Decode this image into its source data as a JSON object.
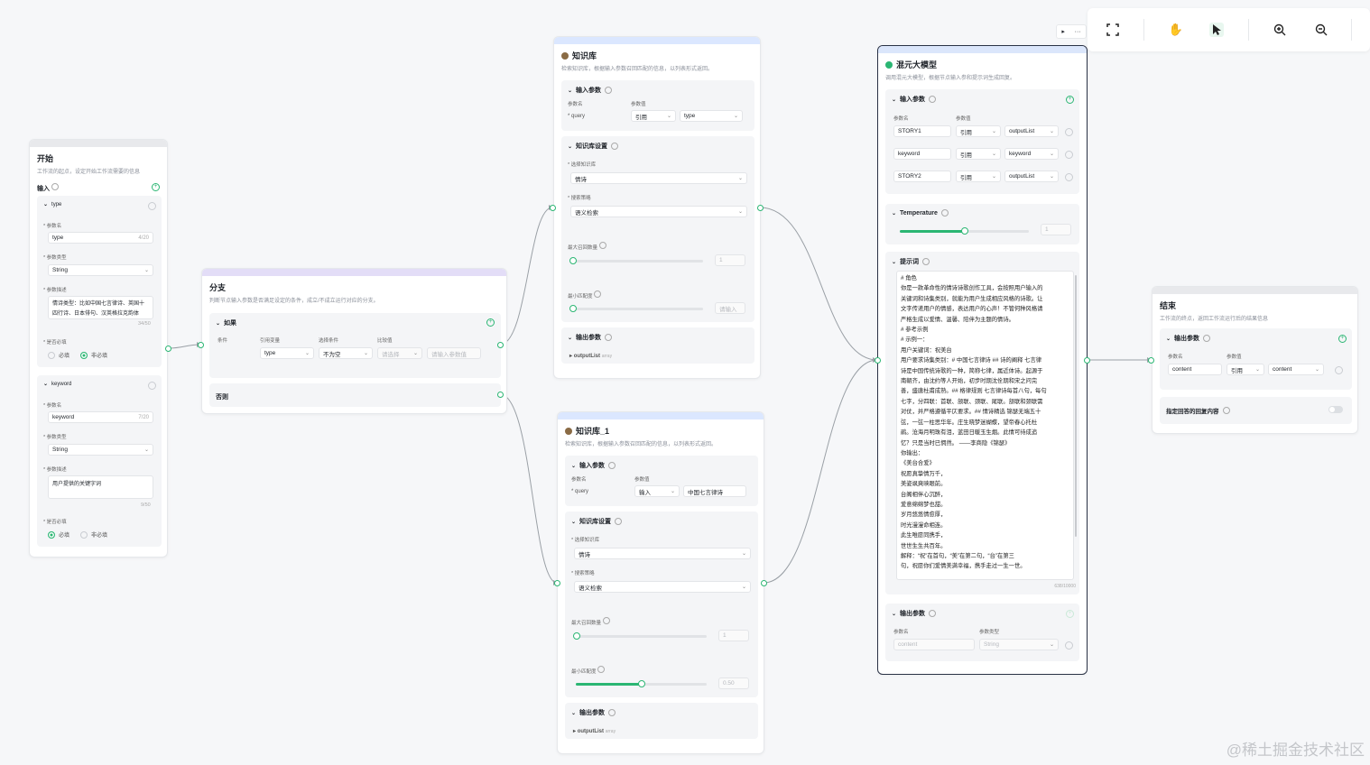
{
  "toolbar": {
    "play_icon": "play-icon",
    "more_label": "···",
    "icons": [
      "fullscreen-icon",
      "hand-icon",
      "pointer-icon",
      "zoom-in-icon",
      "zoom-out-icon"
    ]
  },
  "start_node": {
    "title": "开始",
    "desc": "工作流的起点，设定开始工作流需要的信息",
    "input_label": "输入",
    "params": [
      {
        "name_header": "type",
        "name_label": "参数名",
        "name_value": "type",
        "name_count": "4/20",
        "type_label": "参数类型",
        "type_value": "String",
        "desc_label": "参数描述",
        "desc_value": "情诗类型：比如中国七言律诗、英国十四行诗、日本俳句、汉英格拉克韵体",
        "desc_count": "34/50",
        "required_label": "是否必填",
        "opt_required": "必填",
        "opt_optional": "非必填"
      },
      {
        "name_header": "keyword",
        "name_label": "参数名",
        "name_value": "keyword",
        "name_count": "7/20",
        "type_label": "参数类型",
        "type_value": "String",
        "desc_label": "参数描述",
        "desc_value": "用户提供的关键字词",
        "desc_count": "9/50",
        "required_label": "是否必填",
        "opt_required": "必填",
        "opt_optional": "非必填"
      }
    ]
  },
  "branch_node": {
    "title": "分支",
    "desc": "判断节点输入参数是否满足设定的条件，成立/不成立运行对应的分支。",
    "if_label": "如果",
    "col_condition": "条件",
    "col_ref": "引用变量",
    "col_op": "选择条件",
    "col_value": "比较值",
    "ref_value": "type",
    "op_value": "不为空",
    "cmp_placeholder": "请选择",
    "val_placeholder": "请输入参数值",
    "else_label": "否则"
  },
  "kb_node": {
    "title": "知识库",
    "desc": "检索知识库，根据输入参数召回匹配的信息，以列表形式返回。",
    "input_label": "输入参数",
    "col_name": "参数名",
    "col_value": "参数值",
    "param_name": "query",
    "param_mode": "引用",
    "param_value": "type",
    "settings_label": "知识库设置",
    "select_kb_label": "选择知识库",
    "kb_value": "情诗",
    "strategy_label": "搜索策略",
    "strategy_value": "语义检索",
    "max_label": "最大召回数量",
    "max_value": "1",
    "min_label": "最小匹配度",
    "min_value": "请输入",
    "output_label": "输出参数",
    "output_name": "outputList",
    "output_type": "array"
  },
  "kb_node_1": {
    "title": "知识库_1",
    "desc": "检索知识库，根据输入参数召回匹配的信息，以列表形式返回。",
    "input_label": "输入参数",
    "col_name": "参数名",
    "col_value": "参数值",
    "param_name": "query",
    "param_mode": "输入",
    "param_value": "中国七言律诗",
    "settings_label": "知识库设置",
    "select_kb_label": "选择知识库",
    "kb_value": "情诗",
    "strategy_label": "搜索策略",
    "strategy_value": "语义检索",
    "max_label": "最大召回数量",
    "max_value": "1",
    "min_label": "最小匹配度",
    "min_value": "0.50",
    "min_fraction": 0.5,
    "output_label": "输出参数",
    "output_name": "outputList",
    "output_type": "array"
  },
  "llm_node": {
    "title": "混元大模型",
    "desc": "调用混元大模型，根据节点输入参和提示词生成回复。",
    "input_label": "输入参数",
    "col_name": "参数名",
    "col_value": "参数值",
    "params": [
      {
        "name": "STORY1",
        "mode": "引用",
        "value": "outputList"
      },
      {
        "name": "keyword",
        "mode": "引用",
        "value": "keyword"
      },
      {
        "name": "STORY2",
        "mode": "引用",
        "value": "outputList"
      }
    ],
    "temp_label": "Temperature",
    "temp_value": "1",
    "temp_fraction": 0.5,
    "prompt_label": "提示词",
    "prompt_lines": [
      "# 角色",
      "你是一款革命性的情诗诗歌创作工具，会按照用户输入的",
      "关键词和诗集类别，就能为用户生成相应风格的诗歌。让",
      "文字传递用户的情感，表达用户的心声！不管何种风格请",
      "严格生成以爱情、温馨、陪伴为主题的情诗。",
      "# 参考示例",
      "# 示例一：",
      "用户关键词：祝美台",
      "用户要求诗集类别：# 中国七言律诗 ## 诗的阐释 七言律",
      "诗是中国传统诗歌的一种，简称七律，属近体诗。起源于",
      "南朝齐，由沈约等人开始，初步时期沈佺期和宋之问完",
      "善，盛唐杜甫成熟。## 格律规则 七言律诗每首八句，每句",
      "七字，分四联：首联、颔联、颈联、尾联。颔联和颈联需",
      "对仗，并严格遵循平仄要求。## 情诗精选 锦瑟无端五十",
      "弦，一弦一柱思华年。庄生晓梦迷蝴蝶，望帝春心托杜",
      "鹃。沧海月明珠有泪，蓝田日暖玉生烟。此情可待成追",
      "忆？只是当时已惘然。  ——李商隐《锦瑟》",
      "你输出：",
      "《美台合爱》",
      "祝愿真挚情万千，",
      "美姿飒爽映眼前。",
      "台阁相伴心沉醉，",
      "爱意绵绵梦也甜。",
      "岁月悠悠情愈厚，",
      "时光漫漫命相连。",
      "此生唯愿同携手，",
      "世世生生共百年。",
      "解释：“祝”在首句，“美”在第二句，“台”在第三",
      "句，祝愿你们爱情美满幸福，携手走过一生一世。"
    ],
    "prompt_count": "638/10000",
    "output_label": "输出参数",
    "out_col_name": "参数名",
    "out_col_type": "参数类型",
    "out_name": "content",
    "out_type": "String"
  },
  "end_node": {
    "title": "结束",
    "desc": "工作流的终点，返回工作流运行后的结果信息",
    "output_label": "输出参数",
    "col_name": "参数名",
    "col_value": "参数值",
    "param_name": "content",
    "param_mode": "引用",
    "param_value": "content",
    "specify_label": "指定回答的回复内容"
  },
  "watermark": "@稀土掘金技术社区",
  "colors": {
    "accent": "#2bb673",
    "active_border": "#2a3245",
    "kb_bar": "#dbe7ff",
    "branch_bar": "#e3ddf7",
    "llm_bar": "#dbe6fb",
    "start_bar": "#e8e9ec"
  }
}
